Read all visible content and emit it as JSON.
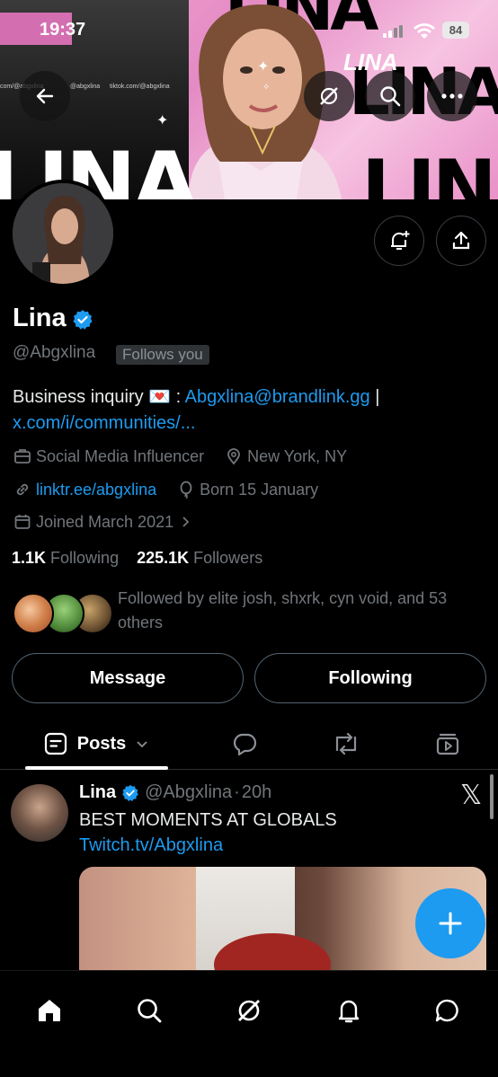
{
  "status_bar": {
    "time": "19:37",
    "battery": "84"
  },
  "banner": {
    "big_text": "LINA",
    "url_left": "com/@abgxlina",
    "url_mid": "@abgxlina",
    "url_right": "tiktok.com/@abgxlina"
  },
  "profile": {
    "name": "Lina",
    "handle": "@Abgxlina",
    "follows_you": "Follows you",
    "bio_prefix": "Business inquiry ",
    "bio_emoji": "💌",
    "bio_sep": " : ",
    "bio_email": "Abgxlina@brandlink.gg",
    "bio_pipe": " | ",
    "bio_link": "x.com/i/communities/...",
    "category": "Social Media Influencer",
    "location": "New York, NY",
    "website": "linktr.ee/abgxlina",
    "birthday": "Born 15 January",
    "joined": "Joined March 2021",
    "following_count": "1.1K",
    "following_label": "Following",
    "followers_count": "225.1K",
    "followers_label": "Followers",
    "followed_by": "Followed by elite josh, shxrk, cyn void, and 53 others"
  },
  "actions": {
    "message": "Message",
    "following": "Following"
  },
  "tabs": {
    "posts": "Posts"
  },
  "post": {
    "name": "Lina",
    "handle": "@Abgxlina",
    "dot": "·",
    "time": "20h",
    "text": "BEST MOMENTS AT GLOBALS",
    "link": "Twitch.tv/Abgxlina",
    "x_logo": "𝕏"
  },
  "colors": {
    "accent": "#1d9bf0",
    "background": "#000000",
    "muted": "#71767b"
  },
  "icons": [
    "back-arrow-icon",
    "grok-icon",
    "search-icon",
    "more-icon",
    "notification-add-icon",
    "share-icon",
    "verified-icon",
    "briefcase-icon",
    "location-icon",
    "link-icon",
    "balloon-icon",
    "calendar-icon",
    "chevron-right-icon",
    "posts-icon",
    "chevron-down-icon",
    "reply-icon",
    "repost-icon",
    "media-icon",
    "compose-plus-icon",
    "home-icon",
    "grok-nav-icon",
    "bell-icon",
    "messages-icon"
  ]
}
